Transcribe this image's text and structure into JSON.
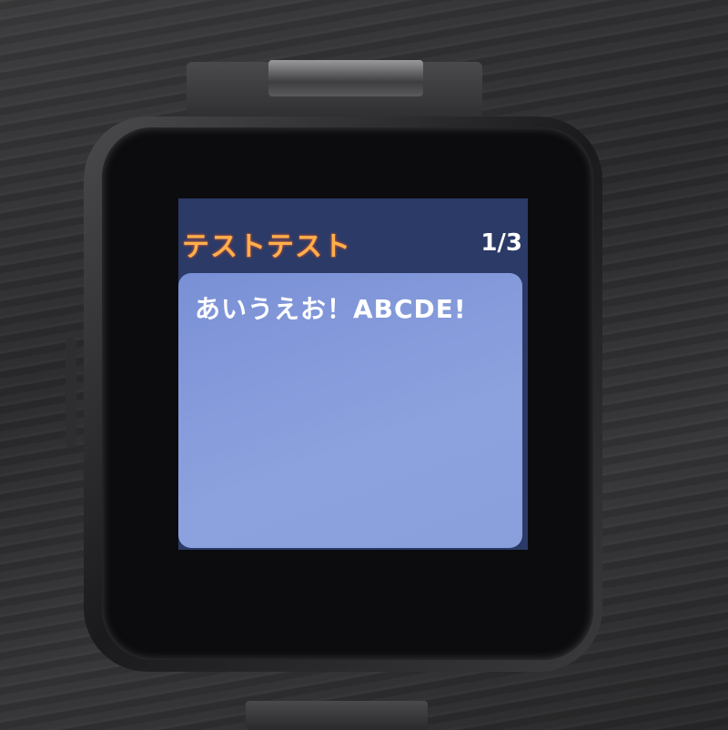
{
  "screen": {
    "title": "テストテスト",
    "page_indicator": "1/3",
    "message": "あいうえお！ABCDE!"
  },
  "colors": {
    "title": "#ffb04a",
    "header_bg": "#2b3a66",
    "card_bg": "#7f98d8"
  }
}
